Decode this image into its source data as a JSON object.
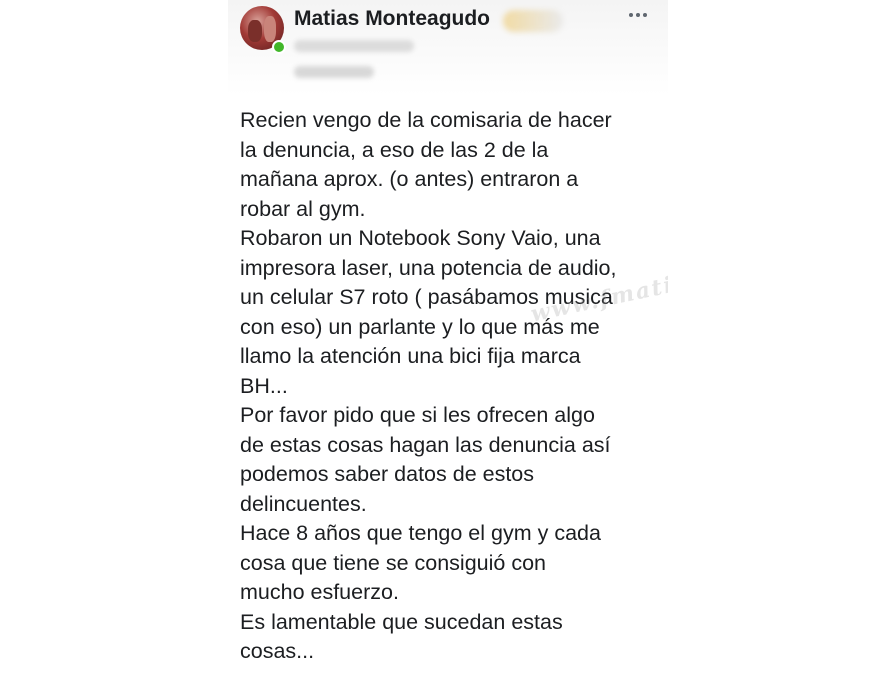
{
  "post": {
    "author": "Matias Monteagudo",
    "status_color": "#42b72a",
    "more_icon": "more-horizontal-icon",
    "lines": [
      "Recien vengo de la comisaria de hacer",
      "la denuncia, a eso de las 2 de la",
      "mañana aprox. (o antes) entraron a",
      "robar al gym.",
      "Robaron un Notebook Sony Vaio, una",
      "impresora laser, una potencia de audio,",
      "un celular S7 roto ( pasábamos musica",
      "con eso) un parlante y lo que más me",
      "llamo la atención una bici fija marca",
      "BH...",
      "Por favor pido que si les ofrecen algo",
      "de estas cosas hagan las denuncia así",
      "podemos saber datos de estos",
      "delincuentes.",
      "Hace 8 años que tengo el gym y cada",
      "cosa que tiene se consiguió con",
      "mucho esfuerzo.",
      "Es lamentable que sucedan estas",
      "cosas..."
    ]
  },
  "watermark": "www.fmatiba.com.ar"
}
